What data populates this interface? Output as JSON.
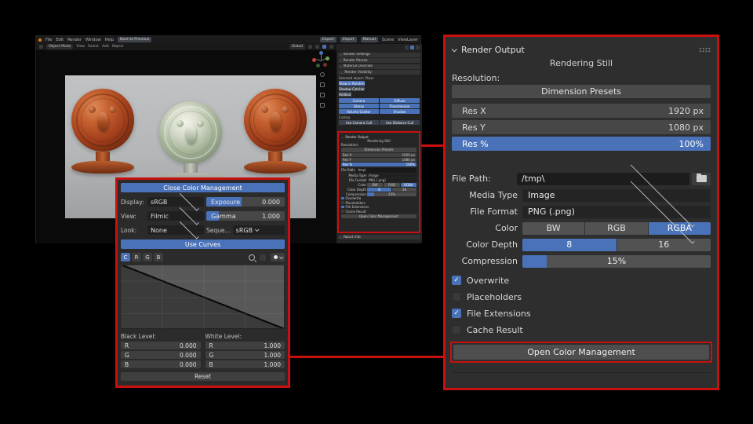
{
  "colors": {
    "accent_red": "#c8100e",
    "accent_blue": "#4a72b8",
    "panel_bg": "#2e2e2e"
  },
  "icons": {
    "header_chevron": "chevron-down",
    "grip": "drag-grip-dots",
    "folder": "open-folder",
    "check": "checkmark",
    "zoom": "magnifier-plus",
    "sample": "eyedropper-dot"
  },
  "blender": {
    "menus": [
      "File",
      "Edit",
      "Render",
      "Window",
      "Help"
    ],
    "back_button": "Back to Previous",
    "header_right": [
      "Export",
      "Import",
      "Manual",
      "Scene",
      "ViewLayer"
    ],
    "toolbar": {
      "mode": "Object Mode",
      "items": [
        "View",
        "Select",
        "Add",
        "Object"
      ],
      "orientation": "Global"
    },
    "props": {
      "sections": [
        "Render Settings",
        "Render Passes",
        "Material Override",
        "Render Visibility"
      ],
      "selected_object": "Selected object: Plane",
      "visibility_buttons": [
        "Show in Renders",
        "Shadow Catcher",
        "Holdout"
      ],
      "ray_buttons": [
        "Camera",
        "Diffuse",
        "Glossy",
        "Transmission",
        "Volume Scatter",
        "Shadow"
      ],
      "culling_label": "Culling",
      "culling_buttons": [
        "Use Camera Cull",
        "Use Distance Cull"
      ],
      "about": "About Info"
    }
  },
  "render_output": {
    "title": "Render Output",
    "status": "Rendering Still",
    "resolution_label": "Resolution:",
    "dimension_presets": "Dimension Presets",
    "res_x_label": "Res X",
    "res_x_value": "1920 px",
    "res_y_label": "Res Y",
    "res_y_value": "1080 px",
    "res_pct_label": "Res %",
    "res_pct_value": "100%",
    "file_path_label": "File Path:",
    "file_path_value": "/tmp\\",
    "media_type_label": "Media Type",
    "media_type_value": "Image",
    "file_format_label": "File Format",
    "file_format_value": "PNG (.png)",
    "color_label": "Color",
    "color_options": [
      "BW",
      "RGB",
      "RGBA"
    ],
    "color_selected": "RGBA",
    "color_depth_label": "Color Depth",
    "color_depth_options": [
      "8",
      "16"
    ],
    "color_depth_selected": "8",
    "compression_label": "Compression",
    "compression_value": "15%",
    "checkboxes": [
      {
        "label": "Overwrite",
        "checked": true
      },
      {
        "label": "Placeholders",
        "checked": false
      },
      {
        "label": "File Extensions",
        "checked": true
      },
      {
        "label": "Cache Result",
        "checked": false
      }
    ],
    "open_cm_button": "Open Color Management"
  },
  "color_management": {
    "close_button": "Close Color Management",
    "display_label": "Display:",
    "display_value": "sRGB",
    "view_label": "View:",
    "view_value": "Filmic",
    "look_label": "Look:",
    "look_value": "None",
    "exposure_label": "Exposure",
    "exposure_value": "0.000",
    "gamma_label": "Gamma",
    "gamma_value": "1.000",
    "sequencer_label": "Seque...",
    "sequencer_value": "sRGB",
    "use_curves_button": "Use Curves",
    "channels": [
      "C",
      "R",
      "G",
      "B"
    ],
    "channel_selected": "C",
    "black_level_label": "Black Level:",
    "white_level_label": "White Level:",
    "black_levels": [
      {
        "ch": "R",
        "v": "0.000"
      },
      {
        "ch": "G",
        "v": "0.000"
      },
      {
        "ch": "B",
        "v": "0.000"
      }
    ],
    "white_levels": [
      {
        "ch": "R",
        "v": "1.000"
      },
      {
        "ch": "G",
        "v": "1.000"
      },
      {
        "ch": "B",
        "v": "1.000"
      }
    ],
    "reset_button": "Reset"
  }
}
